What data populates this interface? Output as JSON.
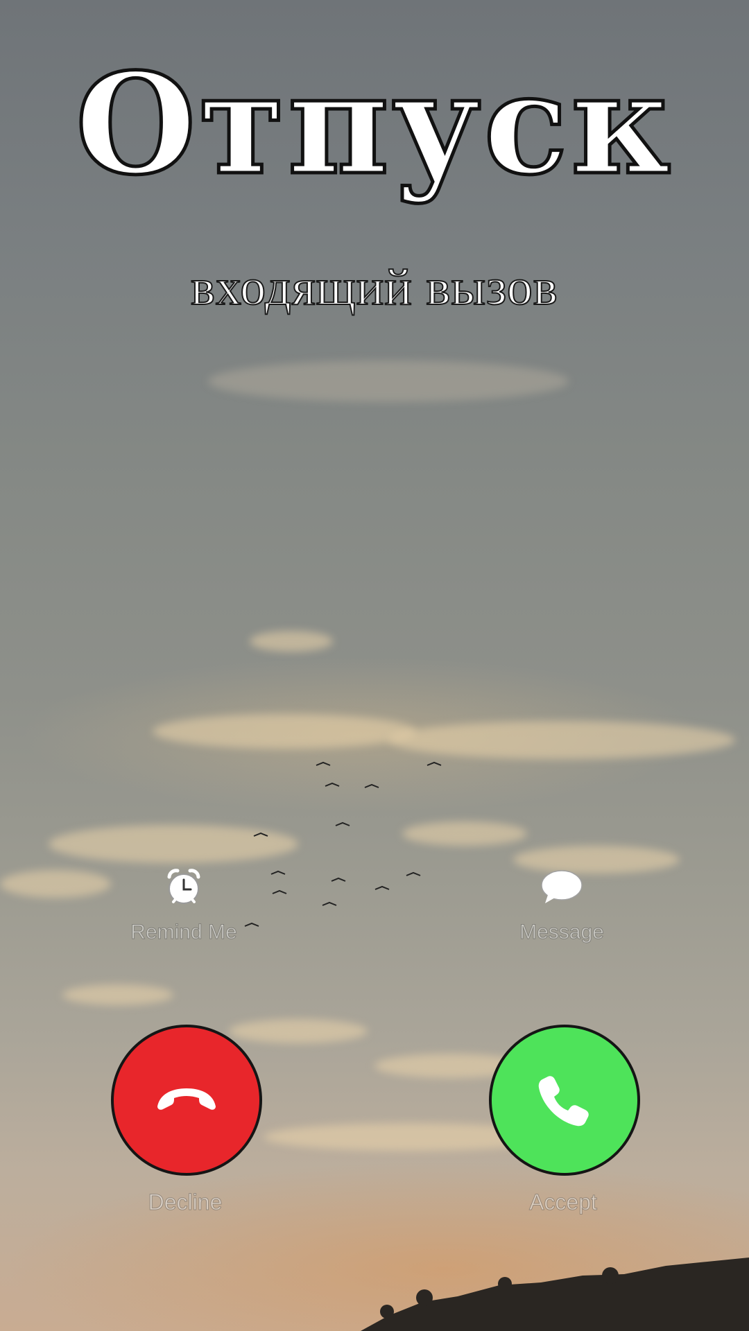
{
  "incoming_call": {
    "caller_name": "Отпуск",
    "status": "входящий вызов"
  },
  "actions": {
    "remind_me": {
      "label": "Remind Me",
      "icon": "alarm-clock-icon"
    },
    "message": {
      "label": "Message",
      "icon": "speech-bubble-icon"
    }
  },
  "buttons": {
    "decline": {
      "label": "Decline",
      "icon": "phone-hangup-icon",
      "color": "#e8262b"
    },
    "accept": {
      "label": "Accept",
      "icon": "phone-icon",
      "color": "#4ee35a"
    }
  }
}
